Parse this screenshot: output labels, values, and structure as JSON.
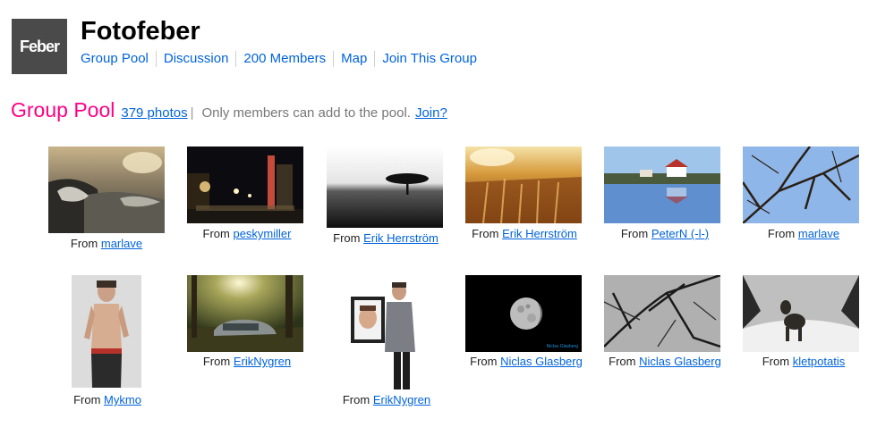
{
  "group": {
    "logo_text": "Feber",
    "name": "Fotofeber",
    "nav": [
      "Group Pool",
      "Discussion",
      "200 Members",
      "Map",
      "Join This Group"
    ]
  },
  "pool": {
    "title": "Group Pool",
    "count": "379 photos",
    "separator": "|",
    "note": "Only members can add to the pool.",
    "join": "Join?"
  },
  "caption_prefix": "From",
  "photos": [
    {
      "owner": "marlave",
      "subject": "coastal-waves"
    },
    {
      "owner": "peskymiller",
      "subject": "night-street"
    },
    {
      "owner": "Erik Herrström",
      "subject": "lone-tree"
    },
    {
      "owner": "Erik Herrström",
      "subject": "wheat-field"
    },
    {
      "owner": "PeterN (-l-)",
      "subject": "lake-houses"
    },
    {
      "owner": "marlave",
      "subject": "tree-branches"
    },
    {
      "owner": "Mykmo",
      "subject": "man-portrait"
    },
    {
      "owner": "ErikNygren",
      "subject": "abandoned-car"
    },
    {
      "owner": "ErikNygren",
      "subject": "man-with-frame"
    },
    {
      "owner": "Niclas Glasberg",
      "subject": "moon"
    },
    {
      "owner": "Niclas Glasberg",
      "subject": "bw-branches"
    },
    {
      "owner": "kletpotatis",
      "subject": "dog-snow"
    }
  ],
  "photo_watermark": "Niclas Glasberg"
}
